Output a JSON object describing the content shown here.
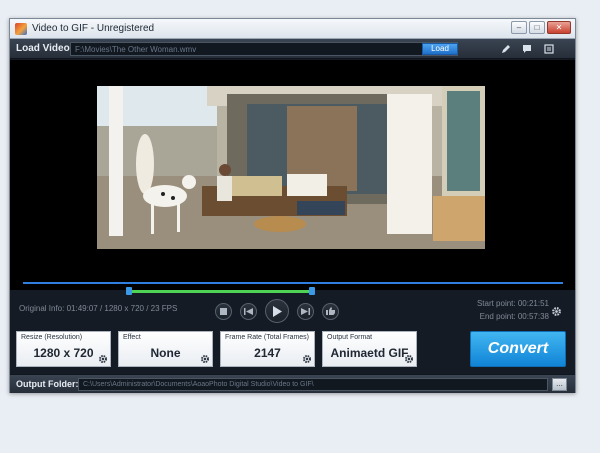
{
  "window": {
    "title": "Video to GIF - Unregistered",
    "controls": {
      "minimize": "–",
      "maximize": "□",
      "close": "✕"
    }
  },
  "load": {
    "label": "Load Video:",
    "path": "F:\\Movies\\The Other Woman.wmv",
    "button": "Load"
  },
  "tools": [
    "edit-icon",
    "comment-icon",
    "list-icon"
  ],
  "video": {
    "frame_icon": "video-frame"
  },
  "timeline": {
    "range_start_fraction": 0.19,
    "range_end_fraction": 0.55
  },
  "info": {
    "original": "Original Info: 01:49:07 / 1280 x 720 / 23 FPS",
    "start_point": "Start point: 00:21:51",
    "end_point": "End point: 00:57:38"
  },
  "settings": {
    "resize": {
      "label": "Resize (Resolution)",
      "value": "1280 x 720"
    },
    "effect": {
      "label": "Effect",
      "value": "None"
    },
    "frame_rate": {
      "label": "Frame Rate (Total Frames)",
      "value": "2147"
    },
    "output_format": {
      "label": "Output Format",
      "value": "Animaetd GIF"
    }
  },
  "convert": {
    "label": "Convert"
  },
  "output": {
    "label": "Output Folder:",
    "path": "C:\\Users\\Administrator\\Documents\\AoaoPhoto Digital Studio\\Video to GIF\\",
    "browse": "..."
  },
  "colors": {
    "accent": "#1f70c9",
    "timeline": "#2f7fe0",
    "range": "#4ed354",
    "convert": "#1184d6"
  }
}
